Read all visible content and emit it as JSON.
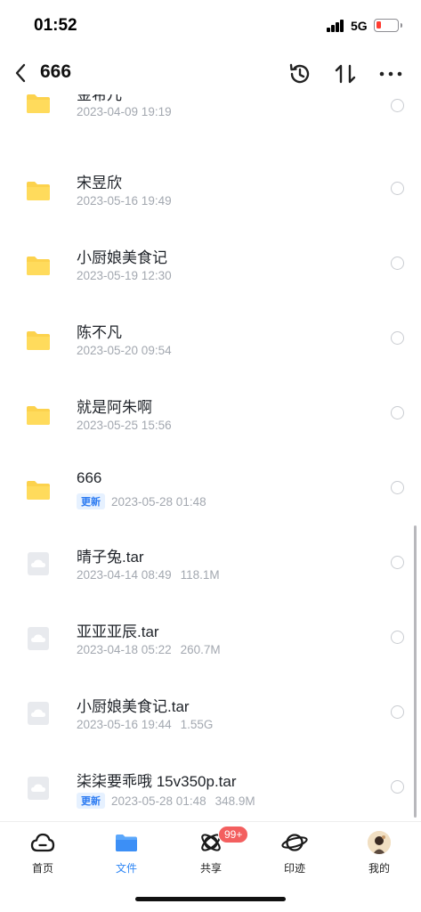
{
  "status_bar": {
    "time": "01:52",
    "network": "5G"
  },
  "nav": {
    "title": "666"
  },
  "files": [
    {
      "type": "folder",
      "name": "金希儿",
      "date": "2023-04-09 19:19",
      "size": "",
      "badge": ""
    },
    {
      "type": "folder",
      "name": "宋昱欣",
      "date": "2023-05-16 19:49",
      "size": "",
      "badge": ""
    },
    {
      "type": "folder",
      "name": "小厨娘美食记",
      "date": "2023-05-19 12:30",
      "size": "",
      "badge": ""
    },
    {
      "type": "folder",
      "name": "陈不凡",
      "date": "2023-05-20 09:54",
      "size": "",
      "badge": ""
    },
    {
      "type": "folder",
      "name": "就是阿朱啊",
      "date": "2023-05-25 15:56",
      "size": "",
      "badge": ""
    },
    {
      "type": "folder",
      "name": "666",
      "date": "2023-05-28 01:48",
      "size": "",
      "badge": "更新"
    },
    {
      "type": "file",
      "name": "晴子兔.tar",
      "date": "2023-04-14 08:49",
      "size": "118.1M",
      "badge": ""
    },
    {
      "type": "file",
      "name": "亚亚亚辰.tar",
      "date": "2023-04-18 05:22",
      "size": "260.7M",
      "badge": ""
    },
    {
      "type": "file",
      "name": "小厨娘美食记.tar",
      "date": "2023-05-16 19:44",
      "size": "1.55G",
      "badge": ""
    },
    {
      "type": "file",
      "name": "柒柒要乖哦 15v350p.tar",
      "date": "2023-05-28 01:48",
      "size": "348.9M",
      "badge": "更新"
    }
  ],
  "tabs": [
    {
      "label": "首页",
      "icon": "cloud-home-icon"
    },
    {
      "label": "文件",
      "icon": "folder-icon"
    },
    {
      "label": "共享",
      "icon": "share-orbit-icon",
      "badge": "99+"
    },
    {
      "label": "印迹",
      "icon": "planet-icon"
    },
    {
      "label": "我的",
      "icon": "avatar-icon"
    }
  ],
  "colors": {
    "accent": "#2e86f5",
    "folder": "#fcd24d",
    "badge_bg": "#e6f1ff",
    "badge_text": "#2c7bf2",
    "notification": "#f35f5f"
  }
}
